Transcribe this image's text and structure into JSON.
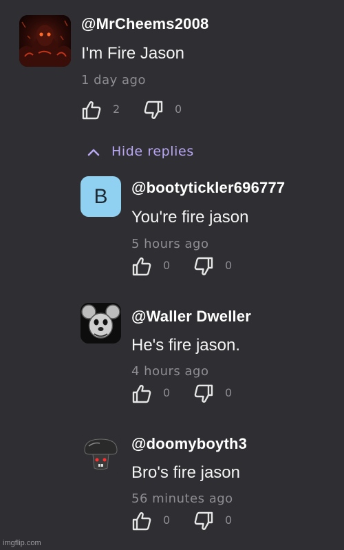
{
  "comments": [
    {
      "author": "@MrCheems2008",
      "text": "I'm Fire Jason",
      "time": "1 day ago",
      "likes": "2",
      "dislikes": "0",
      "avatar_icon": "fire-jason-avatar"
    }
  ],
  "thread": {
    "hide_replies_label": "Hide replies"
  },
  "replies": [
    {
      "author": "@bootytickler696777",
      "text": "You're fire jason",
      "time": "5 hours ago",
      "likes": "0",
      "dislikes": "0",
      "avatar_letter": "B"
    },
    {
      "author": "@Waller Dweller",
      "text": "He's fire jason.",
      "time": "4 hours ago",
      "likes": "0",
      "dislikes": "0",
      "avatar_icon": "mouse-animatronic-avatar"
    },
    {
      "author": "@doomyboyth3",
      "text": "Bro's fire jason",
      "time": "56 minutes ago",
      "likes": "0",
      "dislikes": "0",
      "avatar_icon": "mushroom-avatar"
    }
  ],
  "watermark": "imgflip.com",
  "colors": {
    "background": "#2f2f33",
    "accent": "#b9a6f2",
    "muted": "#8d8d93",
    "letter_avatar_bg": "#90d1f2"
  }
}
